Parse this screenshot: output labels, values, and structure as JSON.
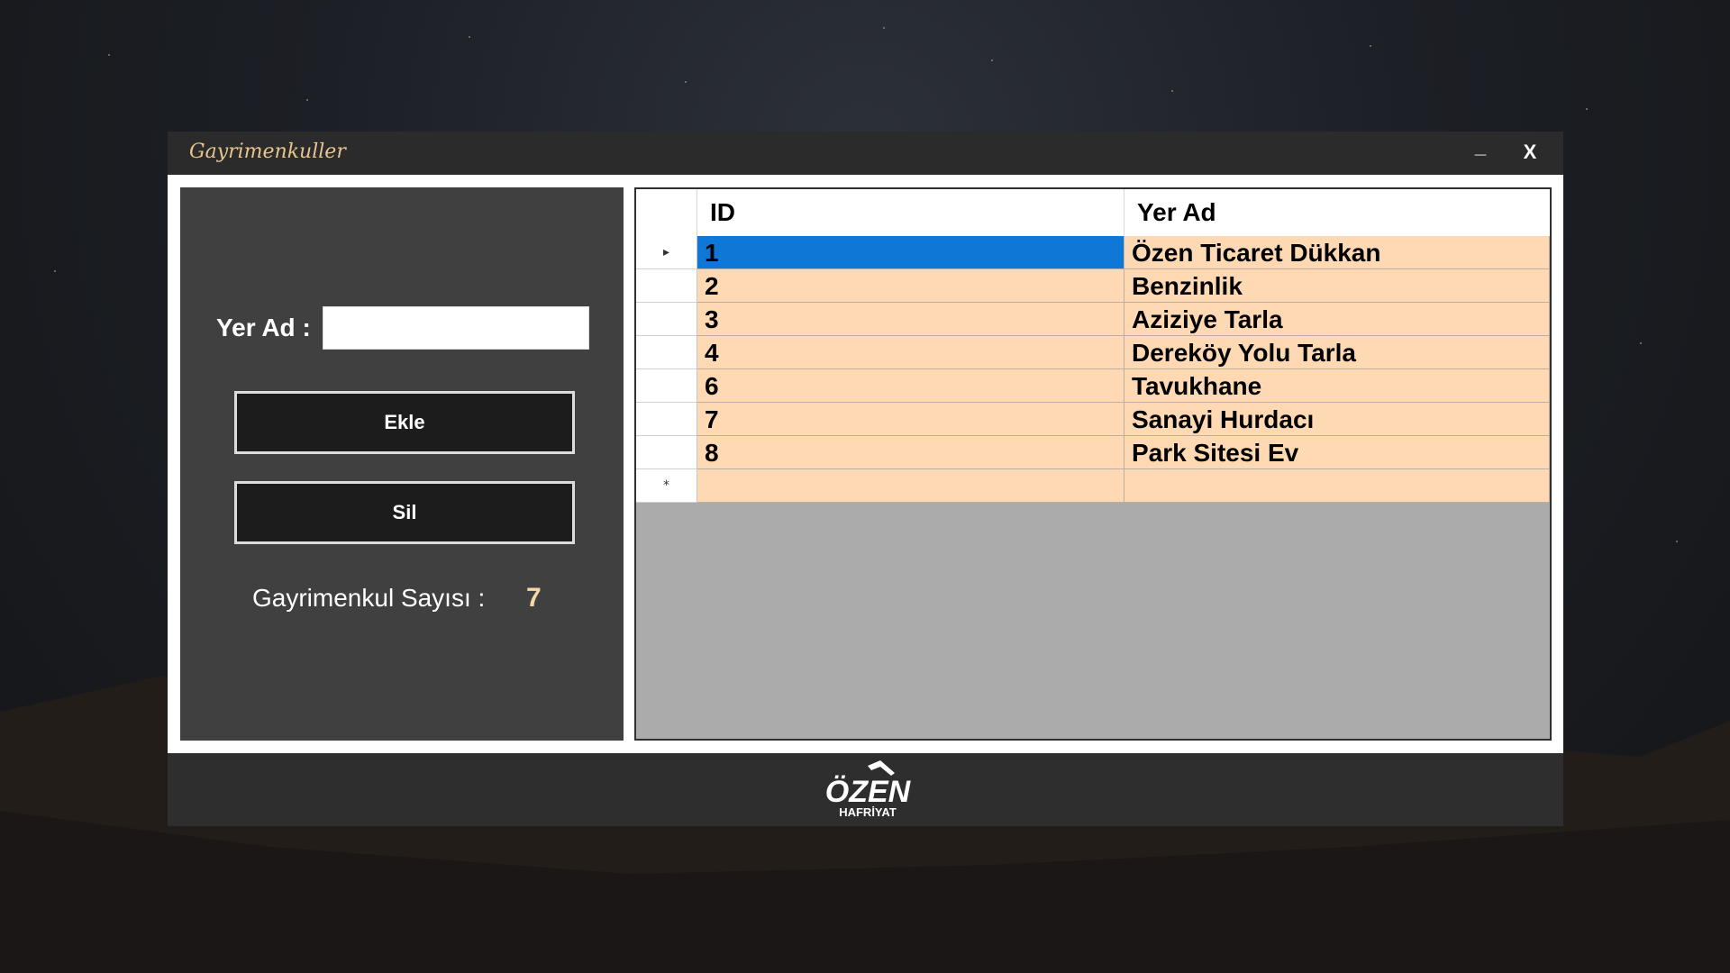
{
  "window": {
    "title": "Gayrimenkuller",
    "minimize_label": "_",
    "close_label": "X"
  },
  "form": {
    "yer_ad_label": "Yer Ad :",
    "yer_ad_value": "",
    "ekle_label": "Ekle",
    "sil_label": "Sil",
    "count_label": "Gayrimenkul Sayısı :",
    "count_value": "7"
  },
  "grid": {
    "columns": [
      "ID",
      "Yer Ad"
    ],
    "rows": [
      {
        "id": "1",
        "yer_ad": "Özen Ticaret Dükkan"
      },
      {
        "id": "2",
        "yer_ad": "Benzinlik"
      },
      {
        "id": "3",
        "yer_ad": "Aziziye Tarla"
      },
      {
        "id": "4",
        "yer_ad": "Dereköy Yolu Tarla"
      },
      {
        "id": "6",
        "yer_ad": "Tavukhane"
      },
      {
        "id": "7",
        "yer_ad": "Sanayi Hurdacı"
      },
      {
        "id": "8",
        "yer_ad": "Park Sitesi Ev"
      }
    ],
    "selected_row": 0,
    "current_row_marker": "▸",
    "new_row_marker": "*"
  },
  "footer": {
    "logo_text": "ÖZEN",
    "logo_subtext": "HAFRİYAT"
  },
  "colors": {
    "titlebar": "#2b2b2b",
    "title_text": "#e8c48f",
    "panel": "#404040",
    "row_background": "#ffd9b3",
    "selected_cell": "#0f78d7",
    "grid_empty": "#ababab",
    "count_value": "#f6d8a6"
  }
}
